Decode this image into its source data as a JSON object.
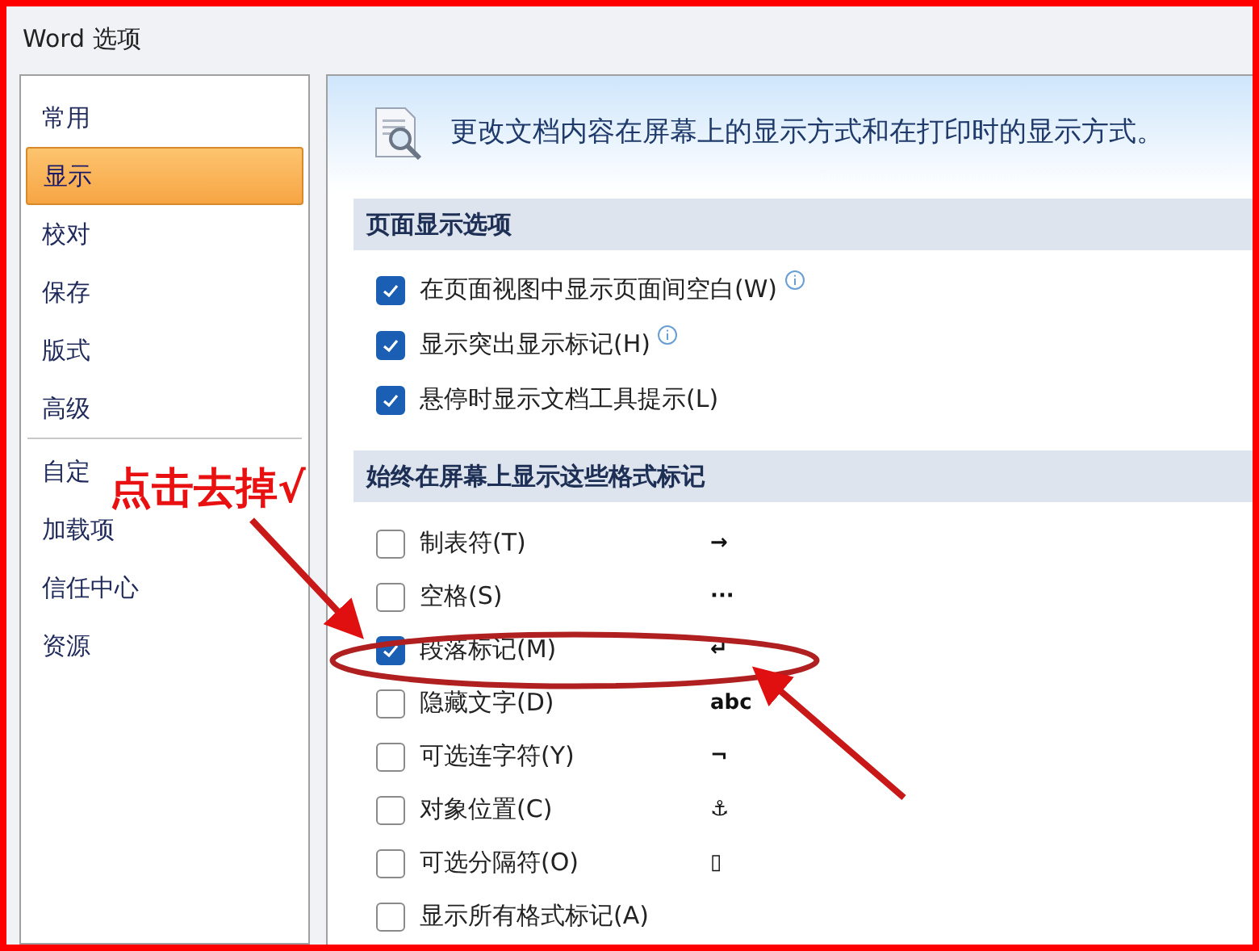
{
  "window": {
    "title": "Word 选项"
  },
  "sidebar": {
    "items": [
      {
        "label": "常用",
        "selected": false
      },
      {
        "label": "显示",
        "selected": true
      },
      {
        "label": "校对",
        "selected": false
      },
      {
        "label": "保存",
        "selected": false
      },
      {
        "label": "版式",
        "selected": false
      },
      {
        "label": "高级",
        "selected": false
      },
      {
        "label": "自定",
        "selected": false
      },
      {
        "label": "加载项",
        "selected": false
      },
      {
        "label": "信任中心",
        "selected": false
      },
      {
        "label": "资源",
        "selected": false
      }
    ]
  },
  "header": {
    "text": "更改文档内容在屏幕上的显示方式和在打印时的显示方式。"
  },
  "sections": [
    {
      "title": "页面显示选项",
      "options": [
        {
          "label": "在页面视图中显示页面间空白(W)",
          "checked": true,
          "info": true
        },
        {
          "label": "显示突出显示标记(H)",
          "checked": true,
          "info": true
        },
        {
          "label": "悬停时显示文档工具提示(L)",
          "checked": true
        }
      ]
    },
    {
      "title": "始终在屏幕上显示这些格式标记",
      "options": [
        {
          "label": "制表符(T)",
          "checked": false,
          "mark": "→"
        },
        {
          "label": "空格(S)",
          "checked": false,
          "mark": "···"
        },
        {
          "label": "段落标记(M)",
          "checked": true,
          "mark": "↵"
        },
        {
          "label": "隐藏文字(D)",
          "checked": false,
          "mark": "abc"
        },
        {
          "label": "可选连字符(Y)",
          "checked": false,
          "mark": "¬"
        },
        {
          "label": "对象位置(C)",
          "checked": false,
          "mark": "⚓"
        },
        {
          "label": "可选分隔符(O)",
          "checked": false,
          "mark": "▯"
        },
        {
          "label": "显示所有格式标记(A)",
          "checked": false
        }
      ]
    }
  ],
  "annotation": {
    "text": "点击去掉√"
  }
}
